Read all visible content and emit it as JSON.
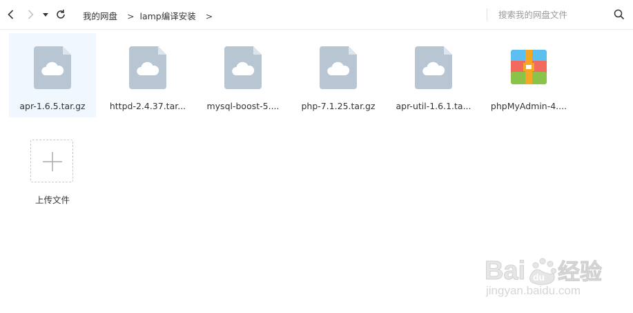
{
  "toolbar": {
    "back_icon": "chevron-left-icon",
    "forward_icon": "chevron-right-icon",
    "history_icon": "caret-down-icon",
    "refresh_icon": "refresh-icon",
    "breadcrumb": [
      {
        "label": "我的网盘"
      },
      {
        "label": "lamp编译安装"
      }
    ],
    "breadcrumb_separator": ">",
    "search_placeholder": "搜索我的网盘文件",
    "search_icon": "search-icon"
  },
  "files": [
    {
      "name": "apr-1.6.5.tar.gz",
      "type": "archive-cloud",
      "selected": true
    },
    {
      "name": "httpd-2.4.37.tar...",
      "type": "archive-cloud",
      "selected": false
    },
    {
      "name": "mysql-boost-5....",
      "type": "archive-cloud",
      "selected": false
    },
    {
      "name": "php-7.1.25.tar.gz",
      "type": "archive-cloud",
      "selected": false
    },
    {
      "name": "apr-util-1.6.1.ta...",
      "type": "archive-cloud",
      "selected": false
    },
    {
      "name": "phpMyAdmin-4....",
      "type": "zip",
      "selected": false
    }
  ],
  "upload": {
    "label": "上传文件",
    "icon": "plus-icon"
  },
  "watermark": {
    "brand": "Baidu经验",
    "url": "jingyan.baidu.com"
  },
  "colors": {
    "selected_bg": "#f1f7fe",
    "file_icon": "#b8c6d4",
    "zip_red": "#f26a5d",
    "zip_blue": "#5bc0f0",
    "zip_green": "#8bc34a",
    "zip_stripe": "#f5a623"
  }
}
